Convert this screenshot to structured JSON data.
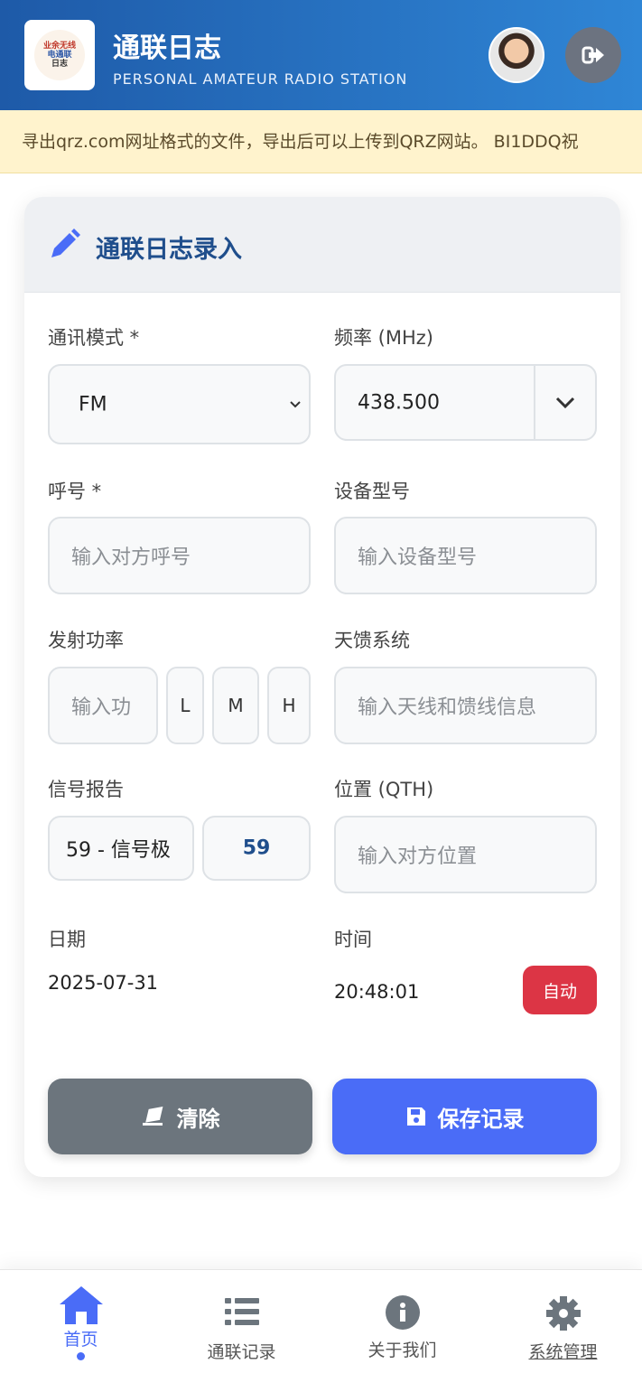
{
  "header": {
    "logo_lines": [
      "业余无线",
      "电通联",
      "日志"
    ],
    "title": "通联日志",
    "subtitle": "PERSONAL AMATEUR RADIO STATION"
  },
  "ticker": {
    "text": "寻出qrz.com网址格式的文件，导出后可以上传到QRZ网站。     BI1DDQ祝"
  },
  "form": {
    "title": "通联日志录入",
    "mode": {
      "label": "通讯模式 *",
      "value": "FM"
    },
    "frequency": {
      "label": "频率 (MHz)",
      "value": "438.500"
    },
    "callsign": {
      "label": "呼号 *",
      "placeholder": "输入对方呼号"
    },
    "device": {
      "label": "设备型号",
      "placeholder": "输入设备型号"
    },
    "power": {
      "label": "发射功率",
      "placeholder": "输入功",
      "levels": [
        "L",
        "M",
        "H"
      ]
    },
    "antenna": {
      "label": "天馈系统",
      "placeholder": "输入天线和馈线信息"
    },
    "signal": {
      "label": "信号报告",
      "select_value": "59 - 信号极",
      "value": "59"
    },
    "qth": {
      "label": "位置 (QTH)",
      "placeholder": "输入对方位置"
    },
    "date": {
      "label": "日期",
      "value": "2025-07-31"
    },
    "time": {
      "label": "时间",
      "value": "20:48:01",
      "auto_label": "自动"
    },
    "clear_label": "清除",
    "save_label": "保存记录"
  },
  "nav": {
    "home": "首页",
    "records": "通联记录",
    "about": "关于我们",
    "admin": "系统管理"
  },
  "colors": {
    "header_start": "#1e5aa8",
    "header_end": "#2f86d6",
    "primary": "#4a6cf7",
    "danger": "#dc3545",
    "secondary": "#6c757d",
    "ticker_bg": "#fff3cd"
  }
}
